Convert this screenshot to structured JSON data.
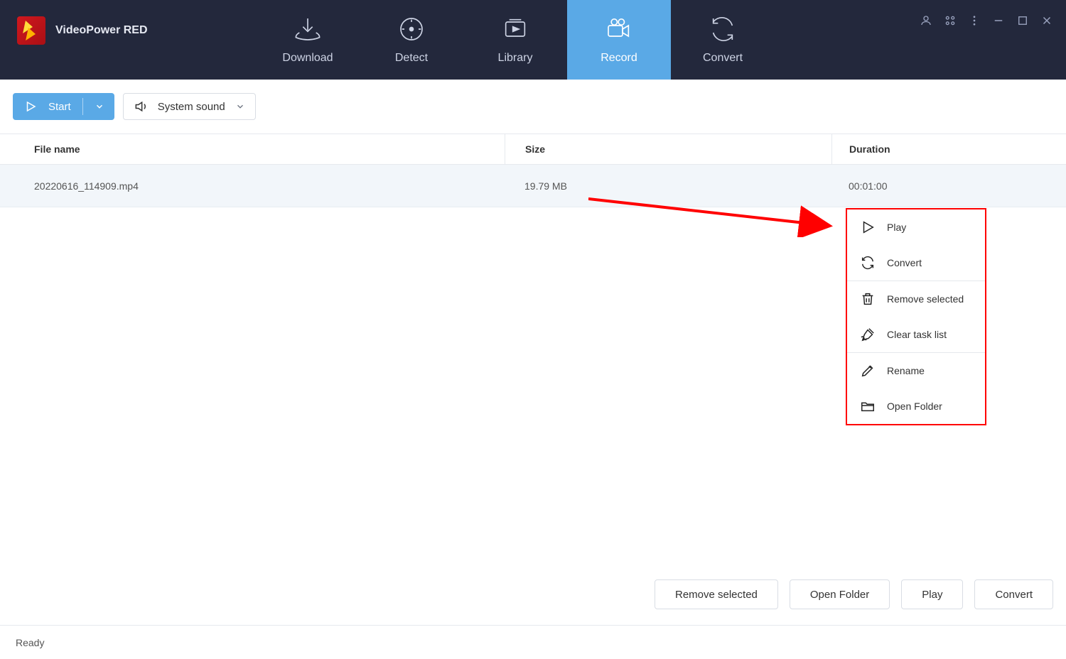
{
  "brand": {
    "title": "VideoPower RED"
  },
  "nav": {
    "download": "Download",
    "detect": "Detect",
    "library": "Library",
    "record": "Record",
    "convert": "Convert"
  },
  "toolbar": {
    "start_label": "Start",
    "audio_label": "System sound"
  },
  "table": {
    "headers": {
      "file": "File name",
      "size": "Size",
      "duration": "Duration"
    },
    "rows": [
      {
        "file": "20220616_114909.mp4",
        "size": "19.79 MB",
        "duration": "00:01:00"
      }
    ]
  },
  "context_menu": {
    "play": "Play",
    "convert": "Convert",
    "remove": "Remove selected",
    "clear": "Clear task list",
    "rename": "Rename",
    "open_folder": "Open Folder"
  },
  "bottom": {
    "remove": "Remove selected",
    "open_folder": "Open Folder",
    "play": "Play",
    "convert": "Convert"
  },
  "status": "Ready"
}
